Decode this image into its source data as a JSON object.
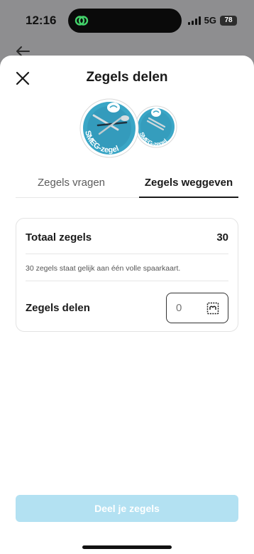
{
  "status_bar": {
    "time": "12:16",
    "network": "5G",
    "battery": "78"
  },
  "sheet": {
    "title": "Zegels delen"
  },
  "badge": {
    "text": "SMEG-zegel"
  },
  "tabs": [
    {
      "label": "Zegels vragen",
      "active": false
    },
    {
      "label": "Zegels weggeven",
      "active": true
    }
  ],
  "card": {
    "total_label": "Totaal zegels",
    "total_value": "30",
    "info_text": "30 zegels staat gelijk aan één volle spaarkaart.",
    "share_label": "Zegels delen",
    "share_value": "0"
  },
  "cta": {
    "label": "Deel je zegels"
  },
  "colors": {
    "badge_teal": "#3aa6c6",
    "badge_dark": "#1f3340",
    "cta_disabled": "#b3e1f2"
  }
}
